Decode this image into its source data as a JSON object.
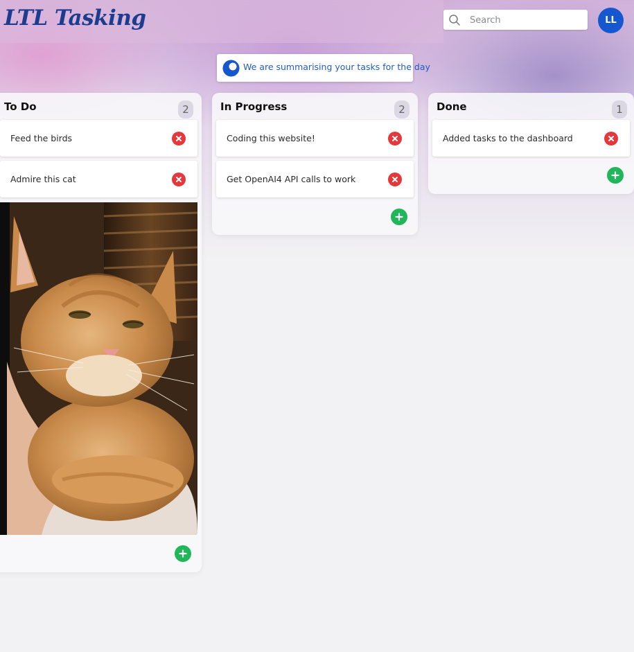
{
  "app": {
    "title": "LTL Tasking"
  },
  "header": {
    "search": {
      "placeholder": "Search",
      "value": ""
    },
    "avatar_initials": "LL"
  },
  "banner": {
    "text": "We are summarising your tasks for the day"
  },
  "colors": {
    "accent": "#1557cf",
    "delete": "#e5383b",
    "add": "#20b65a",
    "logo": "#1b3c8f"
  },
  "columns": [
    {
      "title": "To Do",
      "count": "2",
      "cards": [
        {
          "label": "Feed the birds"
        },
        {
          "label": "Admire this cat"
        }
      ]
    },
    {
      "title": "In Progress",
      "count": "2",
      "cards": [
        {
          "label": "Coding this website!"
        },
        {
          "label": "Get OpenAI4 API calls to work"
        }
      ]
    },
    {
      "title": "Done",
      "count": "1",
      "cards": [
        {
          "label": "Added tasks to the dashboard"
        }
      ]
    }
  ],
  "icons": {
    "search": "search-icon",
    "banner": "spinner-icon",
    "delete": "close-circle-icon",
    "add": "plus-circle-icon"
  }
}
